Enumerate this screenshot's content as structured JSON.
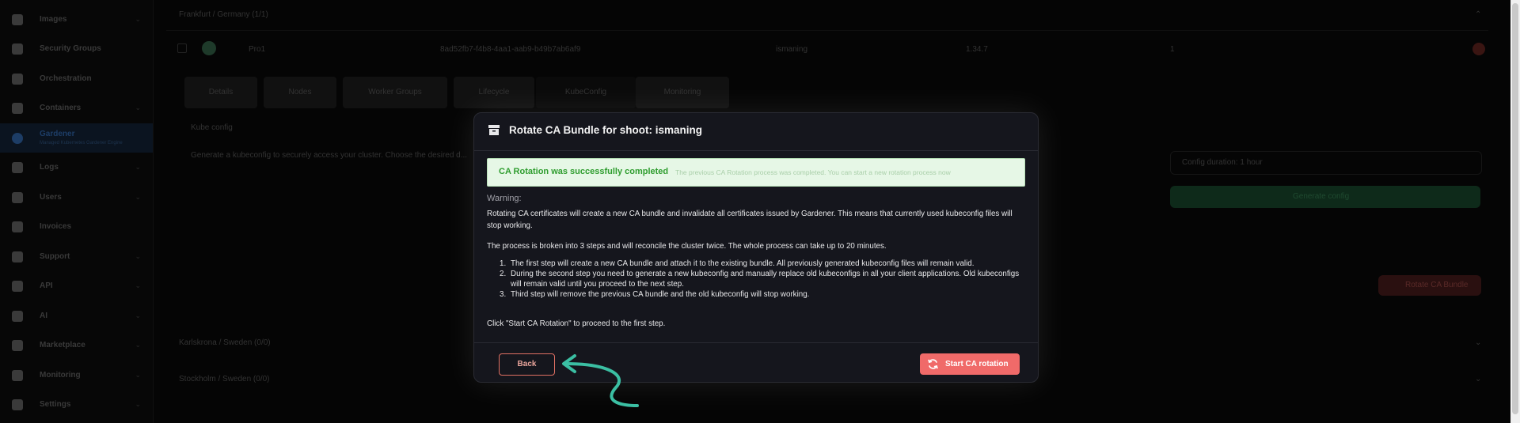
{
  "sidebar": {
    "items": [
      {
        "label": "Images",
        "chevron": true
      },
      {
        "label": "Security Groups",
        "chevron": false
      },
      {
        "label": "Orchestration",
        "chevron": false
      },
      {
        "label": "Containers",
        "chevron": true
      },
      {
        "label": "Gardener",
        "sublabel": "Managed Kubernetes Gardener Engine",
        "chevron": false,
        "active": true
      },
      {
        "label": "Logs",
        "chevron": true
      },
      {
        "label": "Users",
        "chevron": true
      },
      {
        "label": "Invoices",
        "chevron": false
      },
      {
        "label": "Support",
        "chevron": true
      },
      {
        "label": "API",
        "chevron": true
      },
      {
        "label": "AI",
        "chevron": true
      },
      {
        "label": "Marketplace",
        "chevron": true
      },
      {
        "label": "Monitoring",
        "chevron": true
      },
      {
        "label": "Settings",
        "chevron": true
      }
    ]
  },
  "background": {
    "region1": "Frankfurt / Germany (1/1)",
    "cluster": {
      "name": "Pro1",
      "id": "8ad52fb7-f4b8-4aa1-aab9-b49b7ab6af9",
      "shoot": "ismaning",
      "version": "1.34.7",
      "count": "1"
    },
    "tabs": [
      "Details",
      "Nodes",
      "Worker Groups",
      "Lifecycle",
      "KubeConfig",
      "Monitoring"
    ],
    "kube_config_label": "Kube config",
    "kube_desc": "Generate a kubeconfig to securely access your cluster. Choose the desired d...",
    "config_duration": "Config duration: 1 hour",
    "generate_config": "Generate config",
    "rotate_ca_bundle": "Rotate CA Bundle",
    "region2": "Karlskrona / Sweden (0/0)",
    "region3": "Stockholm / Sweden (0/0)"
  },
  "modal": {
    "title": "Rotate CA Bundle for shoot: ismaning",
    "alert_title": "CA Rotation was successfully completed",
    "alert_text": "The previous CA Rotation process was completed. You can start a new rotation process now",
    "warning_heading": "Warning:",
    "para1": "Rotating CA certificates will create a new CA bundle and invalidate all certificates issued by Gardener. This means that currently used kubeconfig files will stop working.",
    "para2": "The process is broken into 3 steps and will reconcile the cluster twice. The whole process can take up to 20 minutes.",
    "steps": [
      "The first step will create a new CA bundle and attach it to the existing bundle. All previously generated kubeconfig files will remain valid.",
      "During the second step you need to generate a new kubeconfig and manually replace old kubeconfigs in all your client applications. Old kubeconfigs will remain valid until you proceed to the next step.",
      "Third step will remove the previous CA bundle and the old kubeconfig will stop working."
    ],
    "step_numbers": [
      "1.",
      "2.",
      "3."
    ],
    "para3": "Click \"Start CA Rotation\" to proceed to the first step.",
    "back_label": "Back",
    "start_label": "Start CA rotation"
  },
  "colors": {
    "accent": "#f06a69",
    "success": "#2e9d2e",
    "arrow": "#3bbfa3"
  }
}
